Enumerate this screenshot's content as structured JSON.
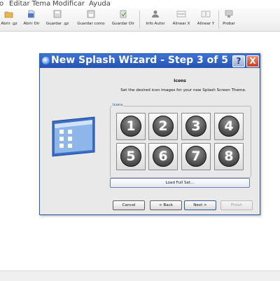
{
  "menu": {
    "items": [
      "o",
      "Editar Tema",
      "Modificar",
      "Ayuda"
    ]
  },
  "toolbar": {
    "buttons": [
      {
        "label": "Abrir .gz",
        "icon": "folder-open-icon"
      },
      {
        "label": "Abrir Dir",
        "icon": "folder-dir-icon"
      },
      {
        "label": "Guardar .gz",
        "icon": "save-gz-icon"
      },
      {
        "label": "Guardar como",
        "icon": "save-as-icon"
      },
      {
        "label": "Guardar Dir",
        "icon": "save-dir-icon"
      },
      {
        "label": "Info Autor",
        "icon": "author-info-icon"
      },
      {
        "label": "Alinear X",
        "icon": "align-x-icon"
      },
      {
        "label": "Alinear Y",
        "icon": "align-y-icon"
      },
      {
        "label": "Probar",
        "icon": "test-preview-icon"
      }
    ]
  },
  "dialog": {
    "title": "New Splash Wizard - Step 3 of 5",
    "title_buttons": {
      "help": "?",
      "close": "X"
    },
    "heading": "Icons",
    "subtitle": "Set the desired icon images for your new Splash Screen Theme.",
    "group_label": "Icons",
    "icon_buttons": [
      "1",
      "2",
      "3",
      "4",
      "5",
      "6",
      "7",
      "8"
    ],
    "load_button": "Load Full Set...",
    "nav": {
      "cancel": "Cancel",
      "back": "< Back",
      "next": "Next >",
      "finish": "Finish"
    },
    "finish_enabled": false
  },
  "colors": {
    "titlebar": "#2653b0",
    "dialog_bg": "#e9e9e9",
    "close_red": "#cf3d1e",
    "group_label": "#1e4fa0"
  }
}
